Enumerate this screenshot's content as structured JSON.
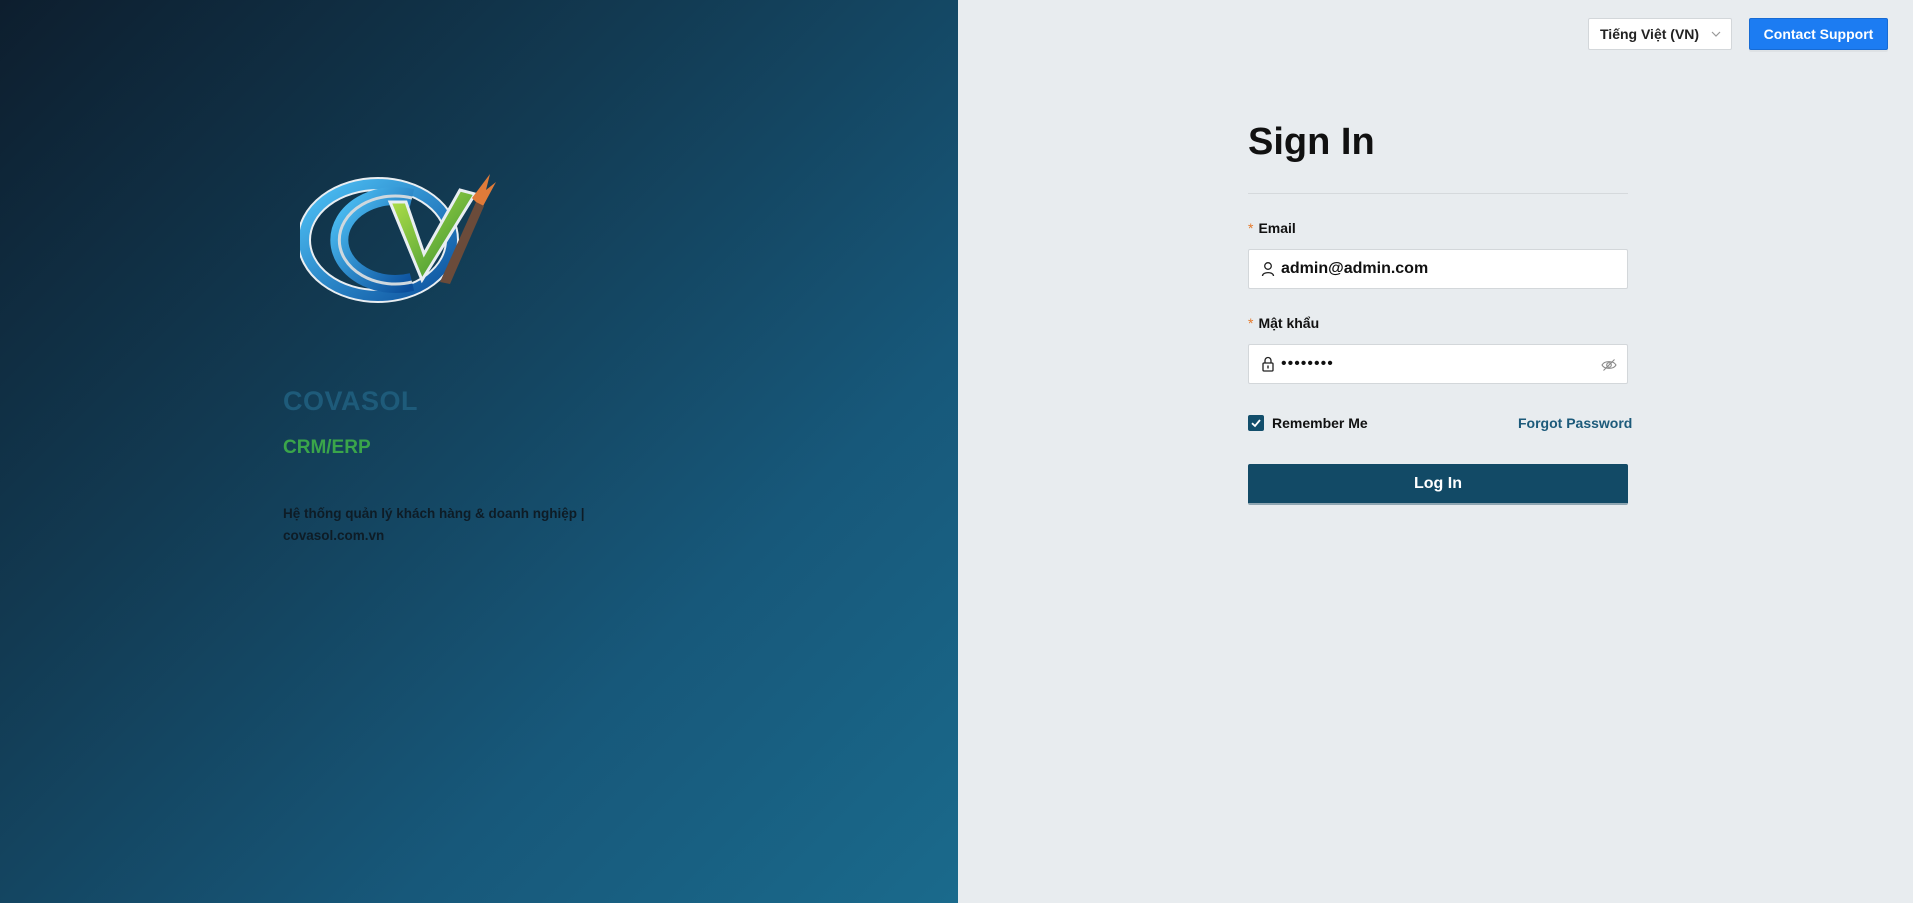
{
  "brand": {
    "name": "COVASOL",
    "subtitle": "CRM/ERP",
    "description": "Hệ thống quản lý khách hàng & doanh nghiệp | covasol.com.vn"
  },
  "header": {
    "language_selected": "Tiếng Việt (VN)",
    "support_label": "Contact Support"
  },
  "form": {
    "title": "Sign In",
    "email_label": "Email",
    "email_value": "admin@admin.com",
    "password_label": "Mật khẩu",
    "password_mask": "••••••••",
    "required_mark": "*",
    "remember_label": "Remember Me",
    "remember_checked": true,
    "forgot_label": "Forgot Password",
    "submit_label": "Log In"
  },
  "icons": {
    "logo": "cv-logo",
    "user": "user-icon",
    "lock": "lock-icon",
    "eye": "eye-invisible-icon",
    "chevron": "chevron-down-icon",
    "check": "check-icon"
  },
  "colors": {
    "primary": "#124a66",
    "support_button": "#1c7cf2",
    "brand_green": "#3aa54a",
    "required": "#e57a2c"
  }
}
